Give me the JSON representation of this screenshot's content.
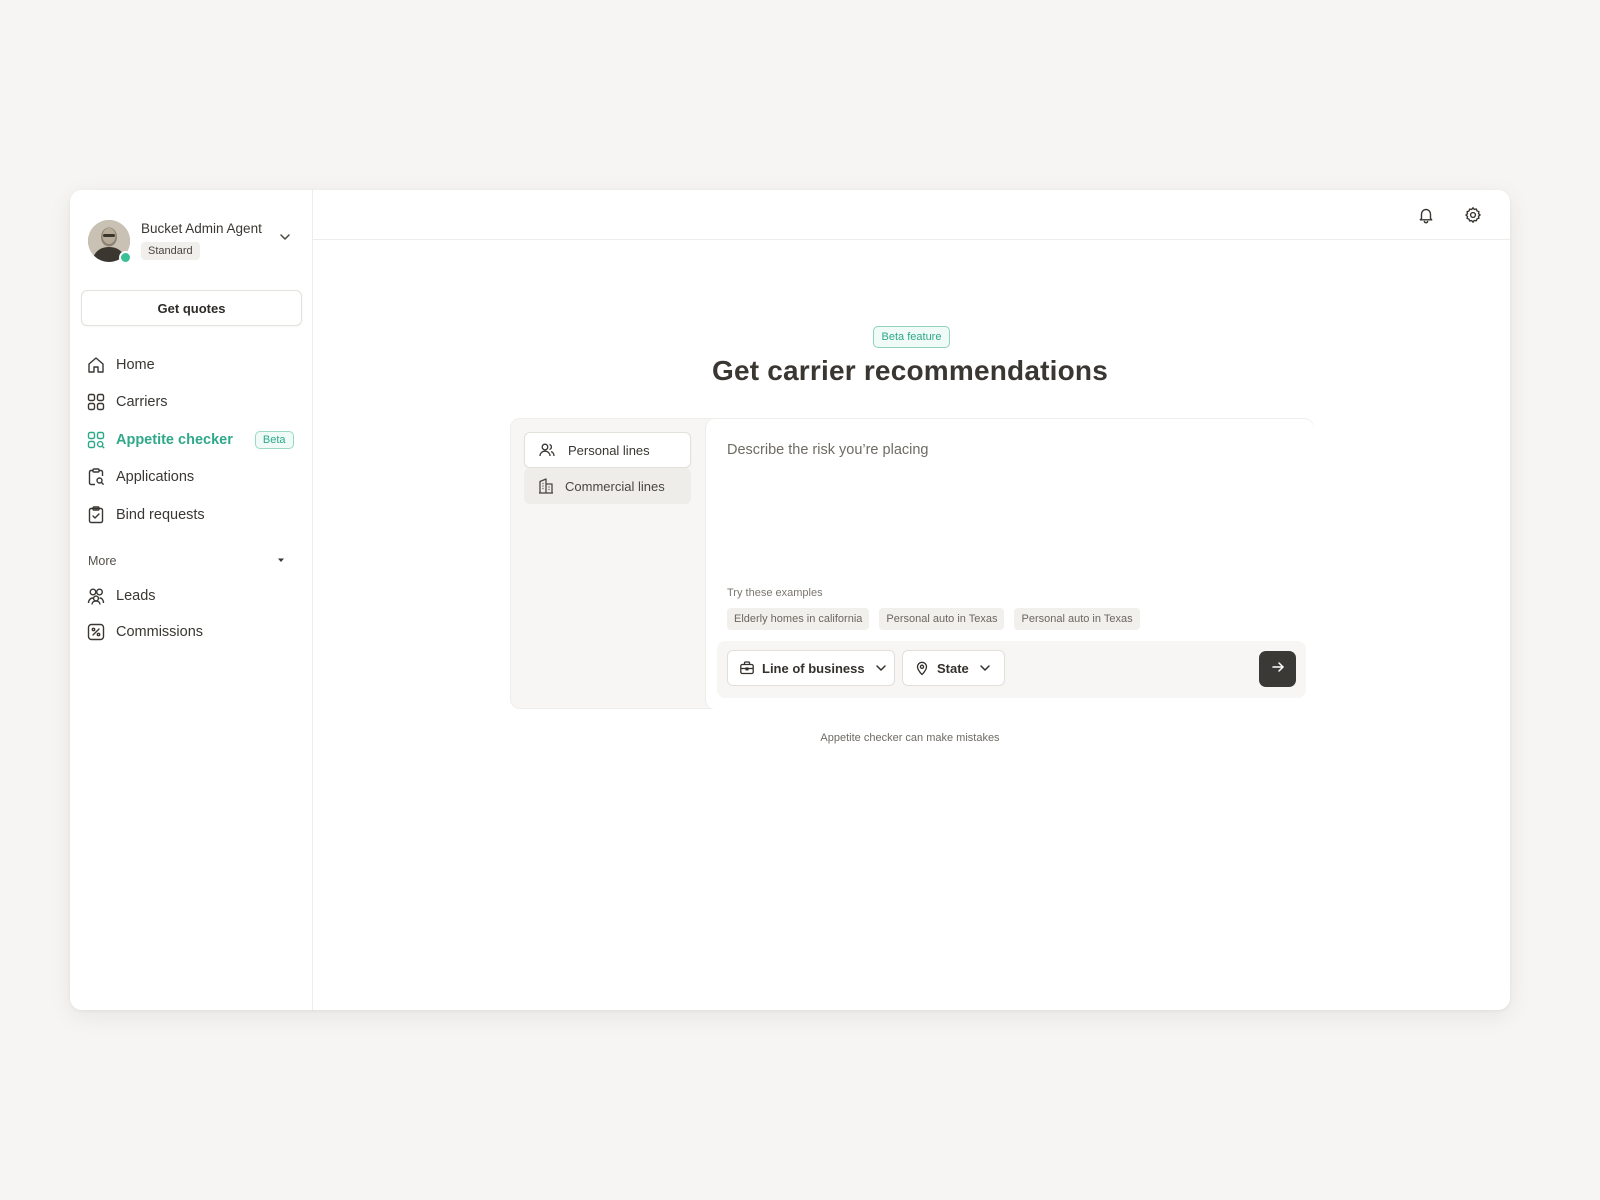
{
  "user": {
    "name": "Bucket Admin Agent",
    "plan": "Standard",
    "status": "online"
  },
  "sidebar": {
    "cta_label": "Get quotes",
    "items": [
      {
        "label": "Home",
        "icon": "home-icon"
      },
      {
        "label": "Carriers",
        "icon": "grid-icon"
      },
      {
        "label": "Appetite checker",
        "icon": "appetite-icon",
        "badge": "Beta",
        "active": true
      },
      {
        "label": "Applications",
        "icon": "clipboard-search-icon"
      },
      {
        "label": "Bind requests",
        "icon": "clipboard-check-icon"
      }
    ],
    "more_label": "More",
    "more_items": [
      {
        "label": "Leads",
        "icon": "users-icon"
      },
      {
        "label": "Commissions",
        "icon": "percent-icon"
      }
    ]
  },
  "topbar": {
    "icons": [
      "bell-icon",
      "gear-icon"
    ]
  },
  "main": {
    "badge": "Beta feature",
    "title": "Get carrier recommendations",
    "tabs": [
      {
        "label": "Personal lines",
        "selected": true
      },
      {
        "label": "Commercial lines",
        "selected": false
      }
    ],
    "prompt_placeholder": "Describe the risk you’re placing",
    "examples_label": "Try these examples",
    "examples": [
      "Elderly homes in california",
      "Personal auto in Texas",
      "Personal auto in Texas"
    ],
    "line_of_business_label": "Line of business",
    "state_label": "State",
    "disclaimer": "Appetite checker can make mistakes"
  },
  "colors": {
    "accent": "#2fa88a",
    "online": "#3bbf95",
    "send_button": "#3b3935",
    "background": "#f6f5f3"
  }
}
